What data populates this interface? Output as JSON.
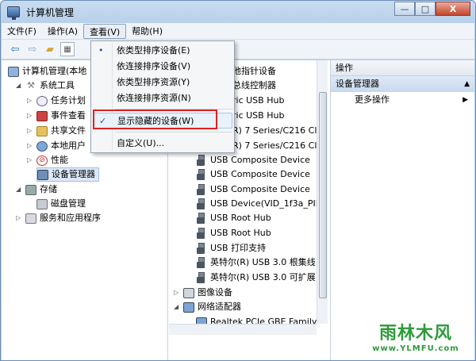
{
  "window": {
    "title": "计算机管理",
    "minimize": "—",
    "maximize": "□",
    "close": "X"
  },
  "menubar": [
    {
      "label": "文件(F)"
    },
    {
      "label": "操作(A)"
    },
    {
      "label": "查看(V)",
      "active": true
    },
    {
      "label": "帮助(H)"
    }
  ],
  "tree": [
    {
      "label": "计算机管理(本地",
      "level": 0,
      "exp": "",
      "icon": "computer-icon"
    },
    {
      "label": "系统工具",
      "level": 1,
      "exp": "◢",
      "icon": "tools-icon"
    },
    {
      "label": "任务计划",
      "level": 2,
      "exp": "▷",
      "icon": "clock-icon"
    },
    {
      "label": "事件查看",
      "level": 2,
      "exp": "▷",
      "icon": "event-viewer-icon"
    },
    {
      "label": "共享文件",
      "level": 2,
      "exp": "▷",
      "icon": "shared-folder-icon"
    },
    {
      "label": "本地用户",
      "level": 2,
      "exp": "▷",
      "icon": "users-icon"
    },
    {
      "label": "性能",
      "level": 2,
      "exp": "▷",
      "icon": "performance-icon"
    },
    {
      "label": "设备管理器",
      "level": 2,
      "exp": "",
      "icon": "device-manager-icon",
      "selected": true
    },
    {
      "label": "存储",
      "level": 1,
      "exp": "◢",
      "icon": "storage-icon"
    },
    {
      "label": "磁盘管理",
      "level": 2,
      "exp": "",
      "icon": "disk-icon"
    },
    {
      "label": "服务和应用程序",
      "level": 1,
      "exp": "▷",
      "icon": "services-icon"
    }
  ],
  "devices_partial": [
    {
      "label": "他指针设备"
    },
    {
      "label": "总线控制器"
    },
    {
      "label": "ric USB Hub"
    },
    {
      "label": "ric USB Hub"
    },
    {
      "label": "R) 7 Series/C216 Cl"
    },
    {
      "label": "R) 7 Series/C216 Cl"
    }
  ],
  "devices": [
    {
      "label": "USB Composite Device",
      "icon": "usb-icon"
    },
    {
      "label": "USB Composite Device",
      "icon": "usb-icon"
    },
    {
      "label": "USB Composite Device",
      "icon": "usb-icon"
    },
    {
      "label": "USB Device(VID_1f3a_PII",
      "icon": "usb-warning-icon"
    },
    {
      "label": "USB Root Hub",
      "icon": "usb-icon"
    },
    {
      "label": "USB Root Hub",
      "icon": "usb-icon"
    },
    {
      "label": "USB 打印支持",
      "icon": "usb-icon"
    },
    {
      "label": "英特尔(R) USB 3.0 根集线",
      "icon": "usb-icon"
    },
    {
      "label": "英特尔(R) USB 3.0 可扩展",
      "icon": "usb-icon"
    }
  ],
  "device_categories": [
    {
      "label": "图像设备",
      "icon": "imaging-device-icon"
    },
    {
      "label": "网络适配器",
      "icon": "network-adapter-icon"
    }
  ],
  "network_device": {
    "label": "Realtek PCIe GBE Family"
  },
  "actions": {
    "header": "操作",
    "group": "设备管理器",
    "more": "更多操作"
  },
  "view_menu": {
    "items": [
      {
        "label": "依类型排序设备(E)",
        "mark": "•"
      },
      {
        "label": "依连接排序设备(V)",
        "mark": ""
      },
      {
        "label": "依类型排序资源(Y)",
        "mark": ""
      },
      {
        "label": "依连接排序资源(N)",
        "mark": ""
      },
      {
        "label": "显示隐藏的设备(W)",
        "mark": "✓",
        "highlighted": true
      },
      {
        "label": "自定义(U)...",
        "mark": ""
      }
    ]
  },
  "watermark": {
    "logo": "雨林木风",
    "url": "www.YLMFU.com"
  },
  "colors": {
    "highlight_box": "#e02020",
    "selection": "#dce8f7",
    "accent": "#2a6fc4"
  }
}
